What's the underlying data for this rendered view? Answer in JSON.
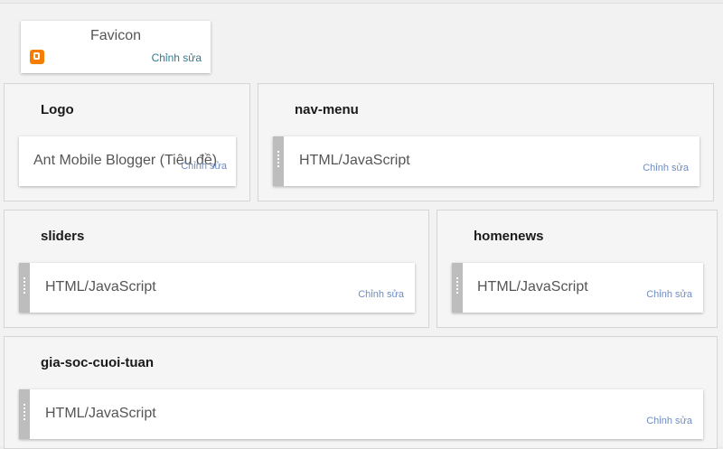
{
  "favicon": {
    "title": "Favicon",
    "icon": "blogger-icon",
    "edit_label": "Chỉnh sửa"
  },
  "sections": {
    "logo": {
      "title": "Logo",
      "widget_label": "Ant Mobile Blogger (Tiêu đề)",
      "edit_label": "Chỉnh sửa"
    },
    "nav_menu": {
      "title": "nav-menu",
      "widget_label": "HTML/JavaScript",
      "edit_label": "Chỉnh sửa"
    },
    "sliders": {
      "title": "sliders",
      "widget_label": "HTML/JavaScript",
      "edit_label": "Chỉnh sửa"
    },
    "homenews": {
      "title": "homenews",
      "widget_label": "HTML/JavaScript",
      "edit_label": "Chỉnh sửa"
    },
    "gia_soc_cuoi_tuan": {
      "title": "gia-soc-cuoi-tuan",
      "widget_label": "HTML/JavaScript",
      "edit_label": "Chỉnh sửa"
    }
  },
  "colors": {
    "edit_link": "#6f8cc4",
    "favicon_edit": "#2e7d91",
    "blogger_orange": "#f57d00",
    "handle": "#bdbdbd"
  }
}
